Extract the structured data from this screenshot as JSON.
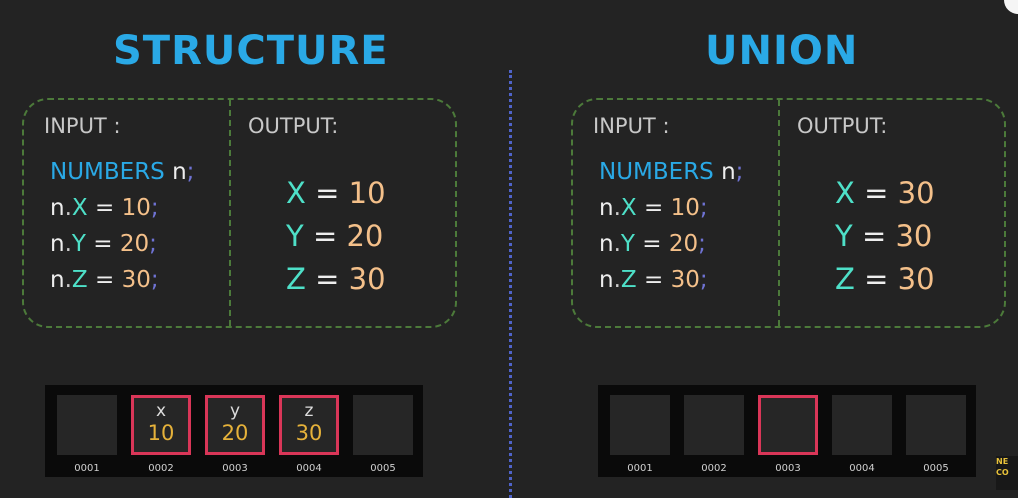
{
  "structure": {
    "title": "STRUCTURE",
    "input_label": "INPUT :",
    "output_label": "OUTPUT:",
    "code": {
      "type": "NUMBERS",
      "var": "n",
      "members": [
        {
          "m": "X",
          "v": "10"
        },
        {
          "m": "Y",
          "v": "20"
        },
        {
          "m": "Z",
          "v": "30"
        }
      ]
    },
    "output": [
      {
        "m": "X",
        "v": "10"
      },
      {
        "m": "Y",
        "v": "20"
      },
      {
        "m": "Z",
        "v": "30"
      }
    ],
    "memory": [
      {
        "name": "",
        "value": "",
        "addr": "0001",
        "highlight": false
      },
      {
        "name": "x",
        "value": "10",
        "addr": "0002",
        "highlight": true
      },
      {
        "name": "y",
        "value": "20",
        "addr": "0003",
        "highlight": true
      },
      {
        "name": "z",
        "value": "30",
        "addr": "0004",
        "highlight": true
      },
      {
        "name": "",
        "value": "",
        "addr": "0005",
        "highlight": false
      }
    ]
  },
  "union": {
    "title": "UNION",
    "input_label": "INPUT :",
    "output_label": "OUTPUT:",
    "code": {
      "type": "NUMBERS",
      "var": "n",
      "members": [
        {
          "m": "X",
          "v": "10"
        },
        {
          "m": "Y",
          "v": "20"
        },
        {
          "m": "Z",
          "v": "30"
        }
      ]
    },
    "output": [
      {
        "m": "X",
        "v": "30"
      },
      {
        "m": "Y",
        "v": "30"
      },
      {
        "m": "Z",
        "v": "30"
      }
    ],
    "memory": [
      {
        "name": "",
        "value": "",
        "addr": "0001",
        "highlight": false
      },
      {
        "name": "",
        "value": "",
        "addr": "0002",
        "highlight": false
      },
      {
        "name": "",
        "value": "",
        "addr": "0003",
        "highlight": true
      },
      {
        "name": "",
        "value": "",
        "addr": "0004",
        "highlight": false
      },
      {
        "name": "",
        "value": "",
        "addr": "0005",
        "highlight": false
      }
    ]
  },
  "logo": {
    "text": "NE\nCO"
  },
  "colors": {
    "title": "#2aa9e6",
    "member": "#4ee0c8",
    "number": "#f4c08a",
    "highlight": "#d93658",
    "divider": "#4f63c9"
  }
}
